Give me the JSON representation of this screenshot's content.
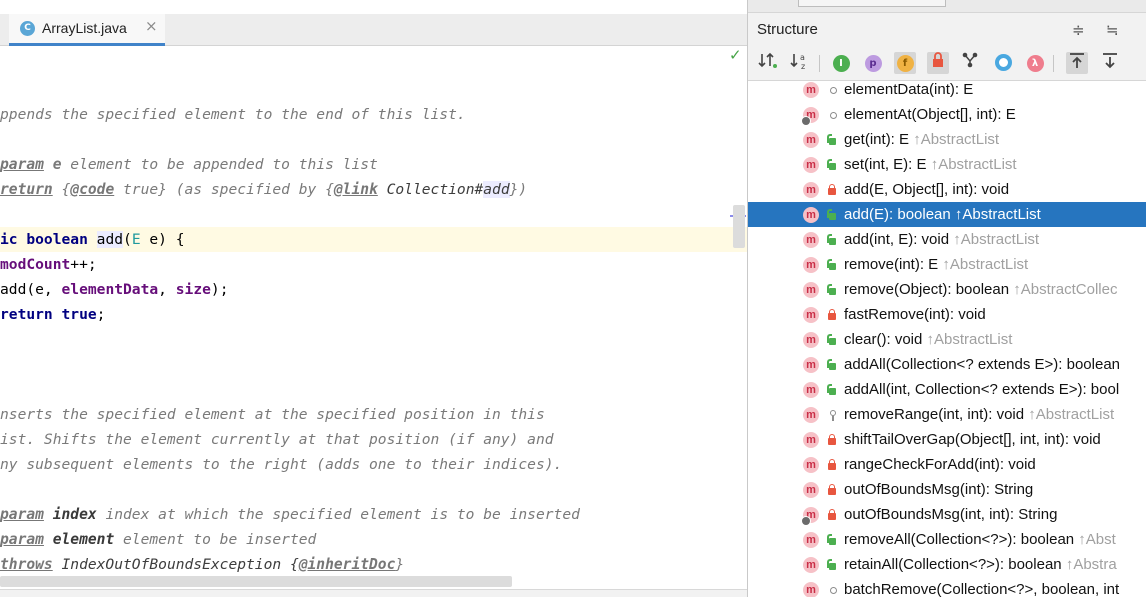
{
  "editor": {
    "tab": {
      "icon": "class-icon",
      "icon_glyph": "C",
      "title": "ArrayList.java",
      "close_glyph": "×"
    },
    "status_glyph": "✓"
  },
  "structure": {
    "title": "Structure",
    "header_buttons": [
      "≑",
      "≒"
    ],
    "toolbar_icons": [
      "sort-visibility-icon",
      "sort-alpha-icon",
      "show-inherited-icon",
      "show-properties-icon",
      "show-fields-icon",
      "show-non-public-icon",
      "show-anonymous-icon",
      "show-lambdas-icon",
      "lambda-icon",
      "autoscroll-to-source-icon",
      "autoscroll-from-source-icon"
    ],
    "toolbar_glyphs": {
      "p": "p",
      "f": "f",
      "lambda": "λ",
      "i": "I"
    },
    "items": [
      {
        "name": "elementData(int): E",
        "inherited": "",
        "access": "package",
        "overlay": false
      },
      {
        "name": "elementAt(Object[], int): E",
        "inherited": "",
        "access": "package",
        "overlay": true
      },
      {
        "name": "get(int): E ",
        "inherited": "↑AbstractList",
        "access": "public",
        "overlay": false
      },
      {
        "name": "set(int, E): E ",
        "inherited": "↑AbstractList",
        "access": "public",
        "overlay": false
      },
      {
        "name": "add(E, Object[], int): void",
        "inherited": "",
        "access": "private",
        "overlay": false
      },
      {
        "name": "add(E): boolean ",
        "inherited": "↑AbstractList",
        "access": "public",
        "overlay": false,
        "selected": true
      },
      {
        "name": "add(int, E): void ",
        "inherited": "↑AbstractList",
        "access": "public",
        "overlay": false
      },
      {
        "name": "remove(int): E ",
        "inherited": "↑AbstractList",
        "access": "public",
        "overlay": false
      },
      {
        "name": "remove(Object): boolean ",
        "inherited": "↑AbstractCollec",
        "access": "public",
        "overlay": false
      },
      {
        "name": "fastRemove(int): void",
        "inherited": "",
        "access": "private",
        "overlay": false
      },
      {
        "name": "clear(): void ",
        "inherited": "↑AbstractList",
        "access": "public",
        "overlay": false
      },
      {
        "name": "addAll(Collection<? extends E>): boolean",
        "inherited": "",
        "access": "public",
        "overlay": false
      },
      {
        "name": "addAll(int, Collection<? extends E>): bool",
        "inherited": "",
        "access": "public",
        "overlay": false
      },
      {
        "name": "removeRange(int, int): void ",
        "inherited": "↑AbstractList",
        "access": "protected",
        "overlay": false
      },
      {
        "name": "shiftTailOverGap(Object[], int, int): void",
        "inherited": "",
        "access": "private",
        "overlay": false
      },
      {
        "name": "rangeCheckForAdd(int): void",
        "inherited": "",
        "access": "private",
        "overlay": false
      },
      {
        "name": "outOfBoundsMsg(int): String",
        "inherited": "",
        "access": "private",
        "overlay": false
      },
      {
        "name": "outOfBoundsMsg(int, int): String",
        "inherited": "",
        "access": "private",
        "overlay": true
      },
      {
        "name": "removeAll(Collection<?>): boolean ",
        "inherited": "↑Abst",
        "access": "public",
        "overlay": false
      },
      {
        "name": "retainAll(Collection<?>): boolean ",
        "inherited": "↑Abstra",
        "access": "public",
        "overlay": false
      },
      {
        "name": "batchRemove(Collection<?>, boolean, int",
        "inherited": "",
        "access": "package",
        "overlay": false
      }
    ]
  },
  "code_lines": [
    {
      "t": "ppends the specified element to the end of this list.",
      "k": "doc"
    },
    {
      "t": "",
      "k": "blank"
    },
    {
      "t": "param",
      "k": "docparam",
      "rest": " e",
      "rest2": " element to be appended to this list"
    },
    {
      "t": "return",
      "k": "docreturn"
    },
    {
      "t": "",
      "k": "blank"
    },
    {
      "t": "ic boolean add(E e) {",
      "k": "sig"
    },
    {
      "t": "modCount",
      "k": "stmt1"
    },
    {
      "t": "add",
      "k": "stmt2"
    },
    {
      "t": "return",
      "k": "stmt3"
    },
    {
      "t": "",
      "k": "blank"
    },
    {
      "t": "",
      "k": "blank"
    },
    {
      "t": "",
      "k": "blank"
    },
    {
      "t": "nserts the specified element at the specified position in this",
      "k": "doc"
    },
    {
      "t": "ist. Shifts the element currently at that position (if any) and",
      "k": "doc"
    },
    {
      "t": "ny subsequent elements to the right (adds one to their indices).",
      "k": "doc"
    },
    {
      "t": "",
      "k": "blank"
    },
    {
      "t": "param",
      "k": "docparam",
      "rest": " index",
      "rest2": " index at which the specified element is to be inserted"
    },
    {
      "t": "param",
      "k": "docparam",
      "rest": " element",
      "rest2": " element to be inserted"
    },
    {
      "t": "throws",
      "k": "docthrows"
    }
  ],
  "code_tokens": {
    "return_code": "@code",
    "return_true": " true} (as specified by {",
    "return_link": "@link",
    "return_coll": " Collection#",
    "return_add": "add",
    "return_end": "})",
    "return_open": " {",
    "sig_kw": "ic boolean ",
    "sig_name": "add",
    "sig_open": "(",
    "sig_type": "E",
    "sig_rest": " e) {",
    "stmt1_rest": "++;",
    "stmt2_open": "(e, ",
    "stmt2_f1": "elementData",
    "stmt2_sep": ", ",
    "stmt2_f2": "size",
    "stmt2_end": ");",
    "stmt3_val": " true",
    "stmt3_end": ";",
    "throws_ex": " IndexOutOfBoundsException {",
    "throws_tag": "@inheritDoc",
    "throws_end": "}"
  }
}
